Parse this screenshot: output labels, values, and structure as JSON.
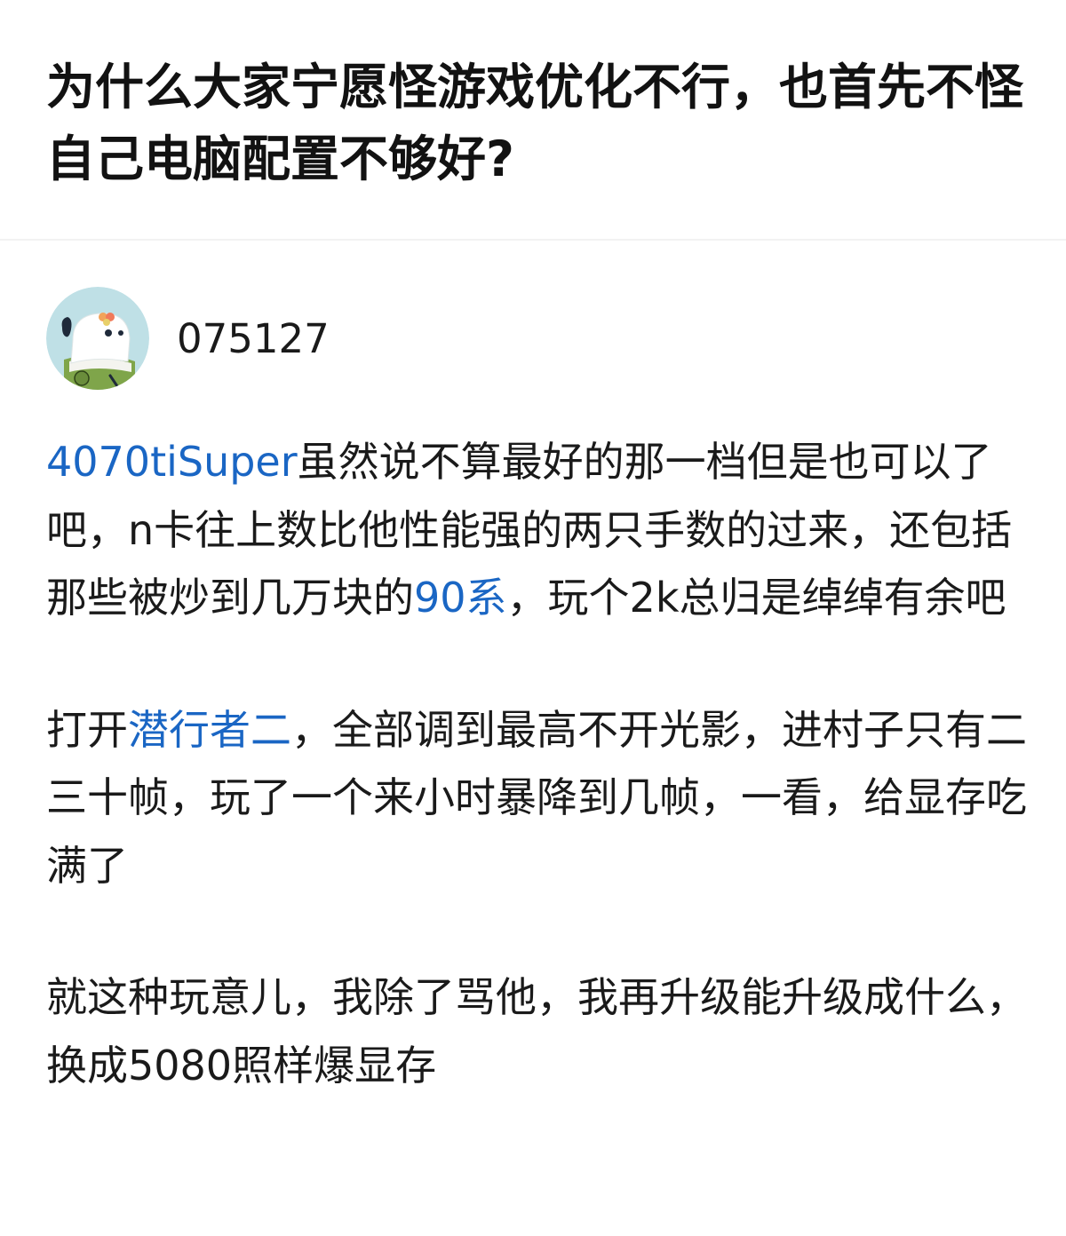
{
  "question": {
    "title": "为什么大家宁愿怪游戏优化不行，也首先不怪自己电脑配置不够好?"
  },
  "answer": {
    "author": {
      "name": "075127",
      "avatar_icon": "cartoon-dog-avatar",
      "avatar_bg": "#bfe0e6"
    },
    "link_color": "#1a66c4",
    "paragraphs": [
      {
        "segments": [
          {
            "text": "4070tiSuper",
            "link": true
          },
          {
            "text": "虽然说不算最好的那一档但是也可以了吧，n卡往上数比他性能强的两只手数的过来，还包括那些被炒到几万块的",
            "link": false
          },
          {
            "text": "90系",
            "link": true
          },
          {
            "text": "，玩个2k总归是绰绰有余吧",
            "link": false
          }
        ]
      },
      {
        "segments": [
          {
            "text": "打开",
            "link": false
          },
          {
            "text": "潜行者二",
            "link": true
          },
          {
            "text": "，全部调到最高不开光影，进村子只有二三十帧，玩了一个来小时暴降到几帧，一看，给显存吃满了",
            "link": false
          }
        ]
      },
      {
        "segments": [
          {
            "text": "就这种玩意儿，我除了骂他，我再升级能升级成什么，换成5080照样爆显存",
            "link": false
          }
        ]
      }
    ]
  }
}
